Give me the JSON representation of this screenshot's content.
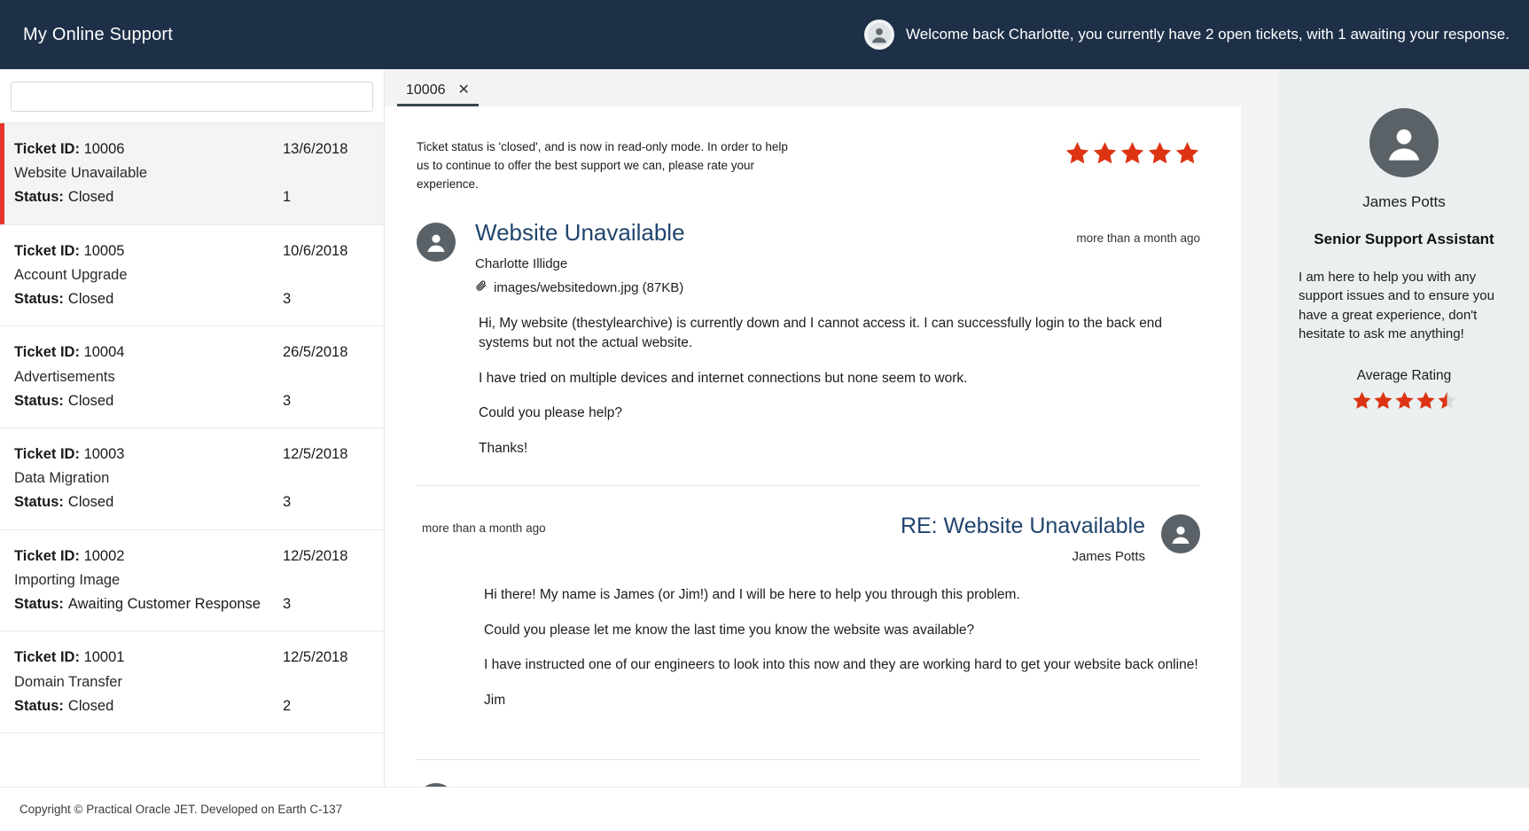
{
  "header": {
    "brand": "My Online Support",
    "avatar_icon": "user-avatar-icon",
    "welcome": "Welcome back Charlotte, you currently have 2 open tickets, with 1 awaiting your response."
  },
  "sidebar": {
    "search_placeholder": "",
    "search_value": "",
    "tickets": [
      {
        "id_label": "Ticket ID:",
        "id": "10006",
        "date": "13/6/2018",
        "subject": "Website Unavailable",
        "status_label": "Status:",
        "status": "Closed",
        "count": "1",
        "selected": true
      },
      {
        "id_label": "Ticket ID:",
        "id": "10005",
        "date": "10/6/2018",
        "subject": "Account Upgrade",
        "status_label": "Status:",
        "status": "Closed",
        "count": "3",
        "selected": false
      },
      {
        "id_label": "Ticket ID:",
        "id": "10004",
        "date": "26/5/2018",
        "subject": "Advertisements",
        "status_label": "Status:",
        "status": "Closed",
        "count": "3",
        "selected": false
      },
      {
        "id_label": "Ticket ID:",
        "id": "10003",
        "date": "12/5/2018",
        "subject": "Data Migration",
        "status_label": "Status:",
        "status": "Closed",
        "count": "3",
        "selected": false
      },
      {
        "id_label": "Ticket ID:",
        "id": "10002",
        "date": "12/5/2018",
        "subject": "Importing Image",
        "status_label": "Status:",
        "status": "Awaiting Customer Response",
        "count": "3",
        "selected": false
      },
      {
        "id_label": "Ticket ID:",
        "id": "10001",
        "date": "12/5/2018",
        "subject": "Domain Transfer",
        "status_label": "Status:",
        "status": "Closed",
        "count": "2",
        "selected": false
      }
    ]
  },
  "tabs": [
    {
      "label": "10006",
      "close_icon": "close-icon",
      "active": true
    }
  ],
  "detail": {
    "status_note": "Ticket status is 'closed', and is now in read-only mode. In order to help us to continue to offer the best support we can, please rate your experience.",
    "rating_stars_filled": 5,
    "rating_stars_total": 5,
    "messages": [
      {
        "kind": "customer",
        "avatar_icon": "user-avatar-icon",
        "title": "Website Unavailable",
        "author": "Charlotte Illidge",
        "time": "more than a month ago",
        "attachment_icon": "paperclip-icon",
        "attachment": "images/websitedown.jpg  (87KB)",
        "paragraphs": [
          "Hi, My website (thestylearchive) is currently down and I cannot access it. I can successfully login to the back end systems but not the actual website.",
          "I have tried on multiple devices and internet connections but none seem to work.",
          "Could you please help?",
          "Thanks!"
        ]
      },
      {
        "kind": "agent",
        "avatar_icon": "user-avatar-icon",
        "title": "RE: Website Unavailable",
        "author": "James Potts",
        "time": "more than a month ago",
        "paragraphs": [
          "Hi there! My name is James (or Jim!) and I will be here to help you through this problem.",
          "Could you please let me know the last time you know the website was available?",
          "I have instructed one of our engineers to look into this now and they are working hard to get your website back online!",
          "Jim"
        ]
      }
    ]
  },
  "agent_panel": {
    "avatar_icon": "user-avatar-icon",
    "name": "James Potts",
    "role": "Senior Support Assistant",
    "blurb": "I am here to help you with any support issues and to ensure you have a great experience, don't hesitate to ask me anything!",
    "average_rating_label": "Average Rating",
    "average_rating_value": 4.5,
    "average_rating_total": 5
  },
  "footer": {
    "text": "Copyright © Practical Oracle JET. Developed on Earth C-137"
  },
  "colors": {
    "header_bg": "#1e3048",
    "accent_red": "#e8352a",
    "star_red": "#dc3412",
    "title_blue": "#21456e",
    "right_panel_bg": "#eceff0"
  }
}
